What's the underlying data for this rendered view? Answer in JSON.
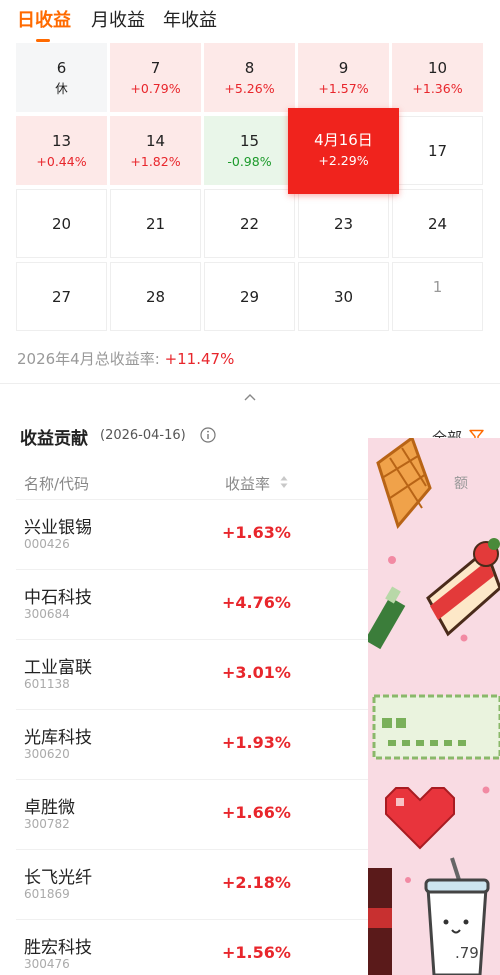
{
  "tabs": [
    {
      "label": "日收益",
      "active": true
    },
    {
      "label": "月收益",
      "active": false
    },
    {
      "label": "年收益",
      "active": false
    }
  ],
  "calendar": {
    "rows": [
      [
        {
          "day": "6",
          "sub": "休",
          "state": "rest"
        },
        {
          "day": "7",
          "sub": "+0.79%",
          "state": "pos"
        },
        {
          "day": "8",
          "sub": "+5.26%",
          "state": "pos"
        },
        {
          "day": "9",
          "sub": "+1.57%",
          "state": "pos"
        },
        {
          "day": "10",
          "sub": "+1.36%",
          "state": "pos"
        }
      ],
      [
        {
          "day": "13",
          "sub": "+0.44%",
          "state": "pos"
        },
        {
          "day": "14",
          "sub": "+1.82%",
          "state": "pos"
        },
        {
          "day": "15",
          "sub": "-0.98%",
          "state": "neg"
        },
        {
          "day": "4月16日",
          "sub": "+2.29%",
          "state": "selected"
        },
        {
          "day": "17",
          "sub": "",
          "state": "plain"
        }
      ],
      [
        {
          "day": "20",
          "sub": "",
          "state": "plain"
        },
        {
          "day": "21",
          "sub": "",
          "state": "plain"
        },
        {
          "day": "22",
          "sub": "",
          "state": "plain"
        },
        {
          "day": "23",
          "sub": "",
          "state": "plain"
        },
        {
          "day": "24",
          "sub": "",
          "state": "plain"
        }
      ],
      [
        {
          "day": "27",
          "sub": "",
          "state": "plain"
        },
        {
          "day": "28",
          "sub": "",
          "state": "plain"
        },
        {
          "day": "29",
          "sub": "",
          "state": "plain"
        },
        {
          "day": "30",
          "sub": "",
          "state": "plain"
        },
        {
          "day": "1",
          "sub": "",
          "state": "future"
        }
      ]
    ]
  },
  "summary": {
    "label": "2026年4月总收益率:",
    "value": "+11.47%"
  },
  "contribution": {
    "title": "收益贡献",
    "date": "(2026-04-16)",
    "all_label": "全部",
    "header_name": "名称/代码",
    "header_rate": "收益率",
    "header_amount_partial": "额",
    "stocks": [
      {
        "name": "兴业银锡",
        "code": "000426",
        "rate": "+1.63%"
      },
      {
        "name": "中石科技",
        "code": "300684",
        "rate": "+4.76%"
      },
      {
        "name": "工业富联",
        "code": "601138",
        "rate": "+3.01%"
      },
      {
        "name": "光库科技",
        "code": "300620",
        "rate": "+1.93%"
      },
      {
        "name": "卓胜微",
        "code": "300782",
        "rate": "+1.66%"
      },
      {
        "name": "长飞光纤",
        "code": "601869",
        "rate": "+2.18%"
      },
      {
        "name": "胜宏科技",
        "code": "300476",
        "rate": "+1.56%"
      }
    ],
    "last_amount_partial": ".79"
  },
  "colors": {
    "accent": "#ff6a00",
    "positive": "#e8262c",
    "negative": "#1c9a2b",
    "selected_bg": "#f0231d",
    "positive_bg": "#fde9e8",
    "negative_bg": "#e9f6e9",
    "sticker_bg": "#f9dbe3"
  },
  "icons": {
    "info": "info-icon",
    "filter": "filter-icon",
    "sort": "sort-icon",
    "collapse": "chevron-up-icon"
  }
}
